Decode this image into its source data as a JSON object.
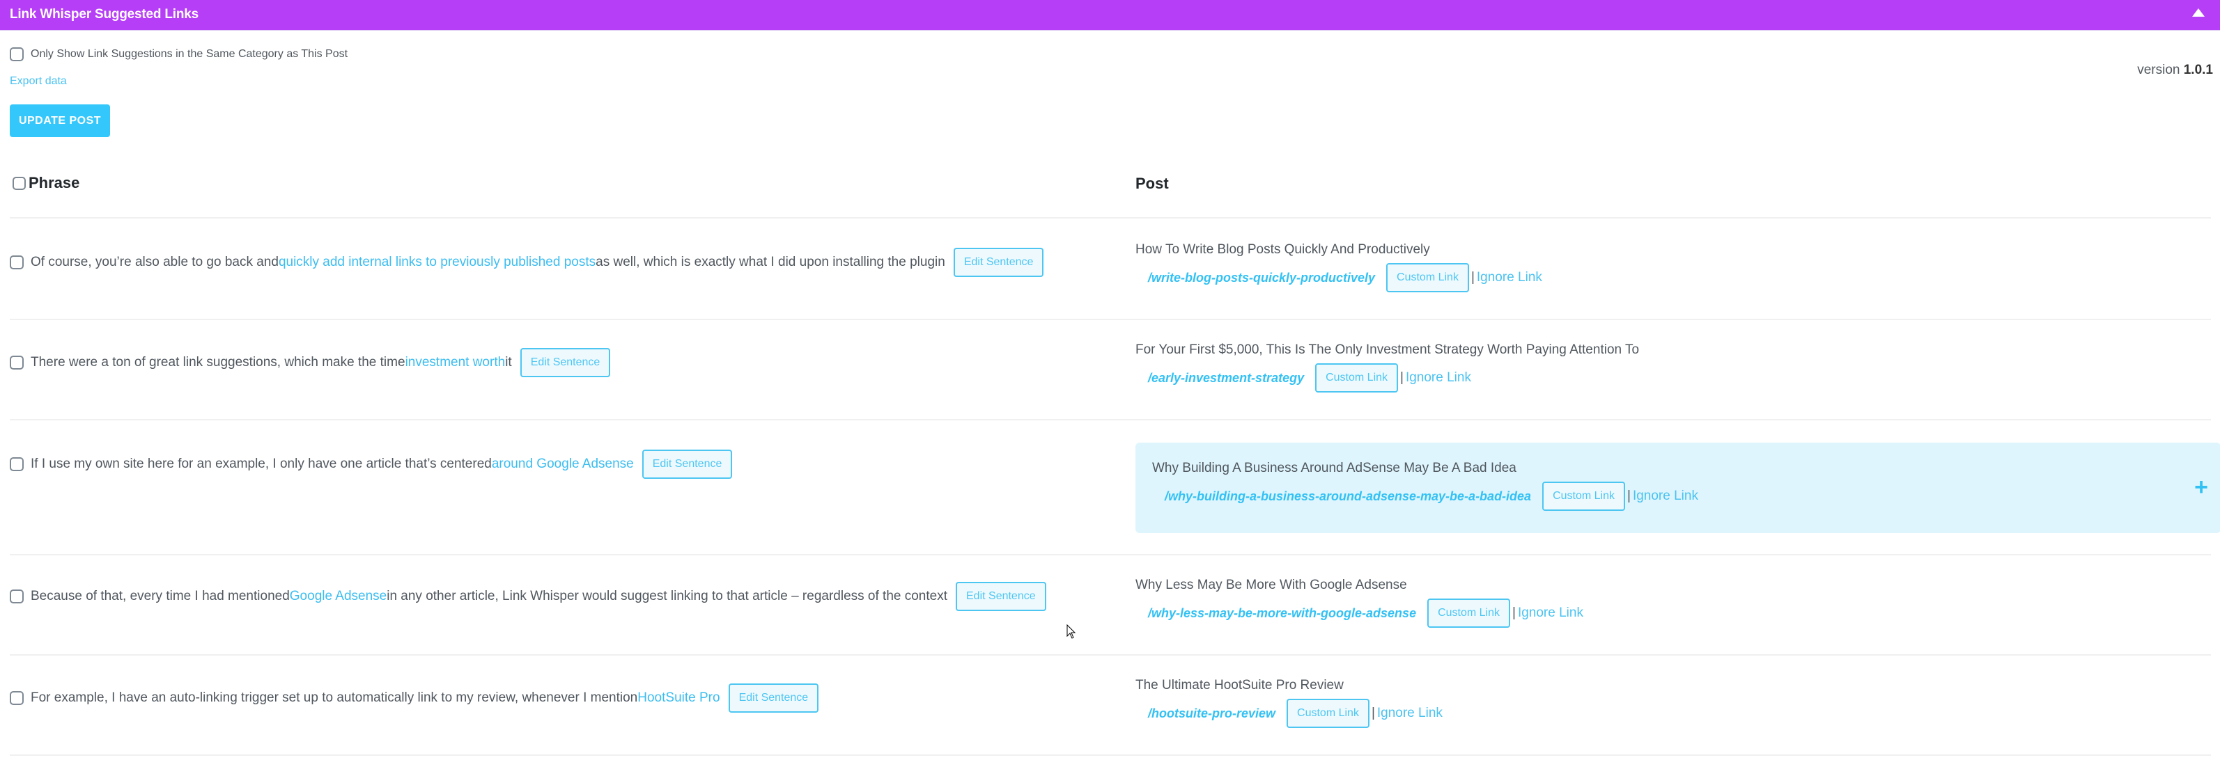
{
  "panel": {
    "title": "Link Whisper Suggested Links",
    "collapse_icon": "triangle-up"
  },
  "options": {
    "same_category_label": "Only Show Link Suggestions in the Same Category as This Post",
    "same_category_checked": false,
    "export_label": "Export data",
    "update_button": "UPDATE POST",
    "version_label": "version",
    "version_number": "1.0.1"
  },
  "table": {
    "phrase_header": "Phrase",
    "post_header": "Post",
    "edit_label": "Edit Sentence",
    "custom_label": "Custom Link",
    "separator": "|",
    "ignore_label": "Ignore Link",
    "rows": [
      {
        "before": "Of course, you’re also able to go back and ",
        "anchor": "quickly add internal links to previously published posts",
        "after": " as well, which is exactly what I did upon installing the plugin",
        "post_title": "How To Write Blog Posts Quickly And Productively",
        "slug": "/write-blog-posts-quickly-productively",
        "highlighted": false
      },
      {
        "before": "There were a ton of great link suggestions, which make the time ",
        "anchor": "investment worth",
        "after": " it",
        "post_title": "For Your First $5,000, This Is The Only Investment Strategy Worth Paying Attention To",
        "slug": "/early-investment-strategy",
        "highlighted": false
      },
      {
        "before": "If I use my own site here for an example, I only have one article that’s centered ",
        "anchor": "around Google Adsense",
        "after": "",
        "post_title": "Why Building A Business Around AdSense May Be A Bad Idea",
        "slug": "/why-building-a-business-around-adsense-may-be-a-bad-idea",
        "highlighted": true,
        "expand_icon": "+"
      },
      {
        "before": "Because of that, every time I had mentioned ",
        "anchor": "Google Adsense",
        "after": " in any other article, Link Whisper would suggest linking to that article – regardless of the context",
        "post_title": "Why Less May Be More With Google Adsense",
        "slug": "/why-less-may-be-more-with-google-adsense",
        "highlighted": false
      },
      {
        "before": "For example, I have an auto-linking trigger set up to automatically link to my review, whenever I mention ",
        "anchor": "HootSuite Pro",
        "after": "",
        "post_title": "The Ultimate HootSuite Pro Review",
        "slug": "/hootsuite-pro-review",
        "highlighted": false
      }
    ]
  },
  "colors": {
    "header_bg": "#b73ef7",
    "accent": "#33c7fb",
    "link": "#4ac2f0",
    "highlight_bg": "#dff5fd"
  }
}
